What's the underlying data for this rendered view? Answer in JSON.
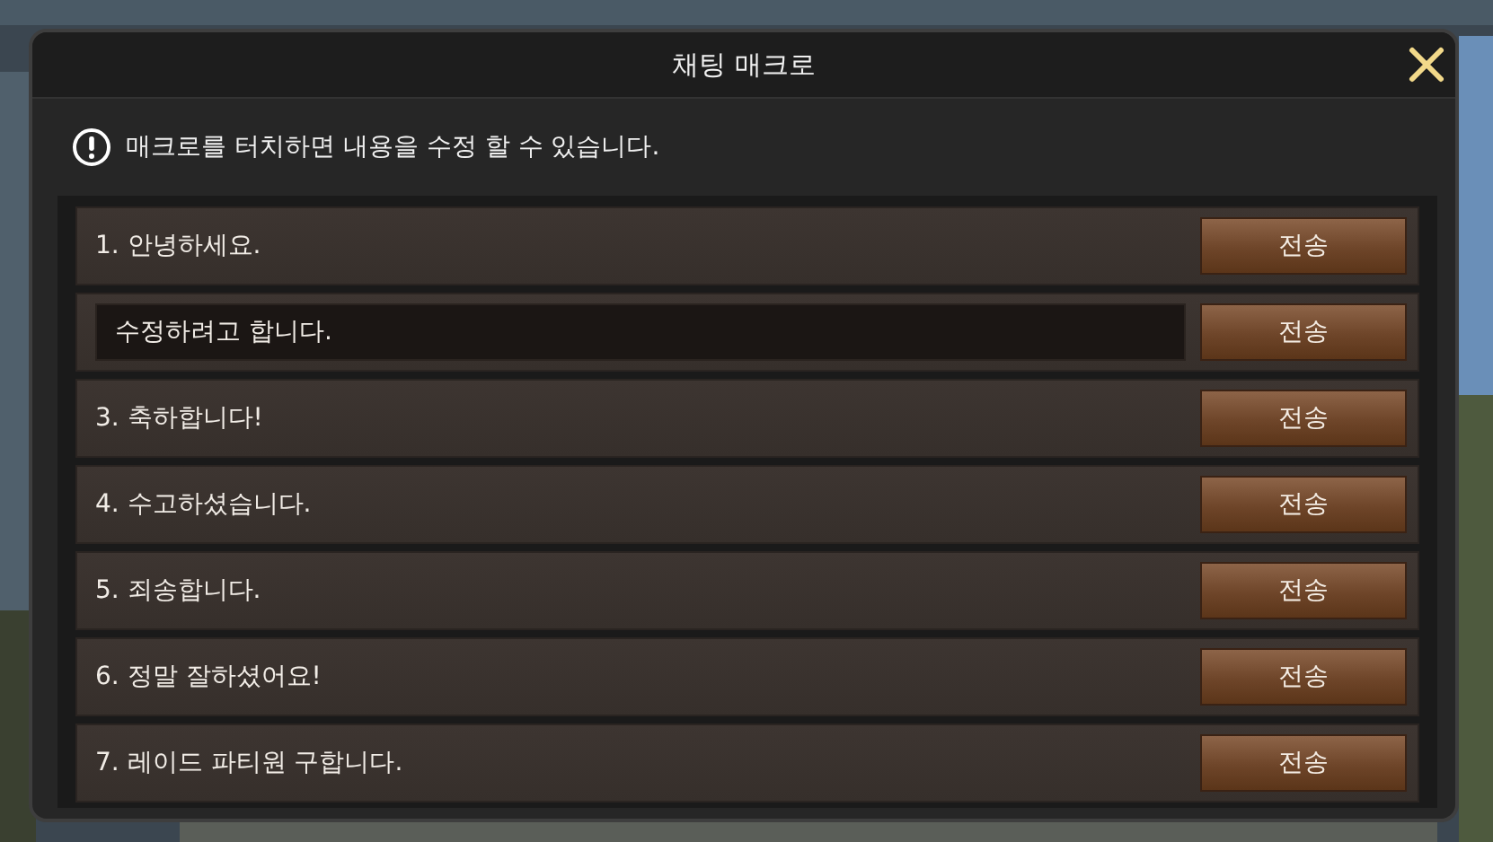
{
  "window": {
    "title": "채팅 매크로"
  },
  "notice": "매크로를 터치하면 내용을 수정 할 수 있습니다.",
  "macros": [
    {
      "kind": "text",
      "text": "1. 안녕하세요.",
      "button": "전송"
    },
    {
      "kind": "edit",
      "value": "수정하려고 합니다.",
      "button": "전송"
    },
    {
      "kind": "text",
      "text": "3. 축하합니다!",
      "button": "전송"
    },
    {
      "kind": "text",
      "text": "4. 수고하셨습니다.",
      "button": "전송"
    },
    {
      "kind": "text",
      "text": "5. 죄송합니다.",
      "button": "전송"
    },
    {
      "kind": "text",
      "text": "6. 정말 잘하셨어요!",
      "button": "전송"
    },
    {
      "kind": "text",
      "text": "7. 레이드 파티원 구합니다.",
      "button": "전송"
    }
  ]
}
